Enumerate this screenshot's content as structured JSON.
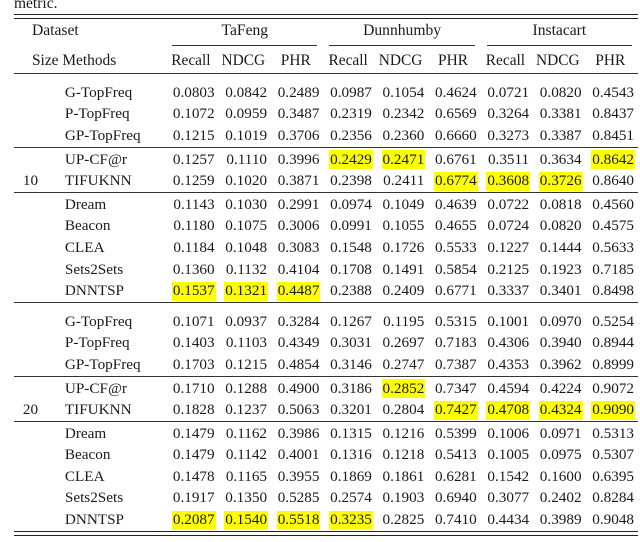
{
  "caption_tail": "metric.",
  "highlight_color": "#ffff00",
  "header": {
    "col_dataset": "Dataset",
    "col_size_methods": "Size Methods",
    "groups": [
      "TaFeng",
      "Dunnhumby",
      "Instacart"
    ],
    "metrics": [
      "Recall",
      "NDCG",
      "PHR"
    ],
    "subheaders": [
      "Recall",
      "NDCG",
      "PHR",
      "Recall",
      "NDCG",
      "PHR",
      "Recall",
      "NDCG",
      "PHR"
    ]
  },
  "sections": [
    {
      "size": "10",
      "size_row_index": 1,
      "blocks": [
        {
          "rows": [
            {
              "method": "G-TopFreq",
              "values": [
                "0.0803",
                "0.0842",
                "0.2489",
                "0.0987",
                "0.1054",
                "0.4624",
                "0.0721",
                "0.0820",
                "0.4543"
              ],
              "highlight": [
                false,
                false,
                false,
                false,
                false,
                false,
                false,
                false,
                false
              ]
            },
            {
              "method": "P-TopFreq",
              "values": [
                "0.1072",
                "0.0959",
                "0.3487",
                "0.2319",
                "0.2342",
                "0.6569",
                "0.3264",
                "0.3381",
                "0.8437"
              ],
              "highlight": [
                false,
                false,
                false,
                false,
                false,
                false,
                false,
                false,
                false
              ]
            },
            {
              "method": "GP-TopFreq",
              "values": [
                "0.1215",
                "0.1019",
                "0.3706",
                "0.2356",
                "0.2360",
                "0.6660",
                "0.3273",
                "0.3387",
                "0.8451"
              ],
              "highlight": [
                false,
                false,
                false,
                false,
                false,
                false,
                false,
                false,
                false
              ]
            }
          ]
        },
        {
          "rows": [
            {
              "method": "UP-CF@r",
              "values": [
                "0.1257",
                "0.1110",
                "0.3996",
                "0.2429",
                "0.2471",
                "0.6761",
                "0.3511",
                "0.3634",
                "0.8642"
              ],
              "highlight": [
                false,
                false,
                false,
                true,
                true,
                false,
                false,
                false,
                true
              ]
            },
            {
              "method": "TIFUKNN",
              "values": [
                "0.1259",
                "0.1020",
                "0.3871",
                "0.2398",
                "0.2411",
                "0.6774",
                "0.3608",
                "0.3726",
                "0.8640"
              ],
              "highlight": [
                false,
                false,
                false,
                false,
                false,
                true,
                true,
                true,
                false
              ]
            }
          ]
        },
        {
          "rows": [
            {
              "method": "Dream",
              "values": [
                "0.1143",
                "0.1030",
                "0.2991",
                "0.0974",
                "0.1049",
                "0.4639",
                "0.0722",
                "0.0818",
                "0.4560"
              ],
              "highlight": [
                false,
                false,
                false,
                false,
                false,
                false,
                false,
                false,
                false
              ]
            },
            {
              "method": "Beacon",
              "values": [
                "0.1180",
                "0.1075",
                "0.3006",
                "0.0991",
                "0.1055",
                "0.4655",
                "0.0724",
                "0.0820",
                "0.4575"
              ],
              "highlight": [
                false,
                false,
                false,
                false,
                false,
                false,
                false,
                false,
                false
              ]
            },
            {
              "method": "CLEA",
              "values": [
                "0.1184",
                "0.1048",
                "0.3083",
                "0.1548",
                "0.1726",
                "0.5533",
                "0.1227",
                "0.1444",
                "0.5633"
              ],
              "highlight": [
                false,
                false,
                false,
                false,
                false,
                false,
                false,
                false,
                false
              ]
            },
            {
              "method": "Sets2Sets",
              "values": [
                "0.1360",
                "0.1132",
                "0.4104",
                "0.1708",
                "0.1491",
                "0.5854",
                "0.2125",
                "0.1923",
                "0.7185"
              ],
              "highlight": [
                false,
                false,
                false,
                false,
                false,
                false,
                false,
                false,
                false
              ]
            },
            {
              "method": "DNNTSP",
              "values": [
                "0.1537",
                "0.1321",
                "0.4487",
                "0.2388",
                "0.2409",
                "0.6771",
                "0.3337",
                "0.3401",
                "0.8498"
              ],
              "highlight": [
                true,
                true,
                true,
                false,
                false,
                false,
                false,
                false,
                false
              ]
            }
          ]
        }
      ]
    },
    {
      "size": "20",
      "size_row_index": 1,
      "blocks": [
        {
          "rows": [
            {
              "method": "G-TopFreq",
              "values": [
                "0.1071",
                "0.0937",
                "0.3284",
                "0.1267",
                "0.1195",
                "0.5315",
                "0.1001",
                "0.0970",
                "0.5254"
              ],
              "highlight": [
                false,
                false,
                false,
                false,
                false,
                false,
                false,
                false,
                false
              ]
            },
            {
              "method": "P-TopFreq",
              "values": [
                "0.1403",
                "0.1103",
                "0.4349",
                "0.3031",
                "0.2697",
                "0.7183",
                "0.4306",
                "0.3940",
                "0.8944"
              ],
              "highlight": [
                false,
                false,
                false,
                false,
                false,
                false,
                false,
                false,
                false
              ]
            },
            {
              "method": "GP-TopFreq",
              "values": [
                "0.1703",
                "0.1215",
                "0.4854",
                "0.3146",
                "0.2747",
                "0.7387",
                "0.4353",
                "0.3962",
                "0.8999"
              ],
              "highlight": [
                false,
                false,
                false,
                false,
                false,
                false,
                false,
                false,
                false
              ]
            }
          ]
        },
        {
          "rows": [
            {
              "method": "UP-CF@r",
              "values": [
                "0.1710",
                "0.1288",
                "0.4900",
                "0.3186",
                "0.2852",
                "0.7347",
                "0.4594",
                "0.4224",
                "0.9072"
              ],
              "highlight": [
                false,
                false,
                false,
                false,
                true,
                false,
                false,
                false,
                false
              ]
            },
            {
              "method": "TIFUKNN",
              "values": [
                "0.1828",
                "0.1237",
                "0.5063",
                "0.3201",
                "0.2804",
                "0.7427",
                "0.4708",
                "0.4324",
                "0.9090"
              ],
              "highlight": [
                false,
                false,
                false,
                false,
                false,
                true,
                true,
                true,
                true
              ]
            }
          ]
        },
        {
          "rows": [
            {
              "method": "Dream",
              "values": [
                "0.1479",
                "0.1162",
                "0.3986",
                "0.1315",
                "0.1216",
                "0.5399",
                "0.1006",
                "0.0971",
                "0.5313"
              ],
              "highlight": [
                false,
                false,
                false,
                false,
                false,
                false,
                false,
                false,
                false
              ]
            },
            {
              "method": "Beacon",
              "values": [
                "0.1479",
                "0.1142",
                "0.4001",
                "0.1316",
                "0.1218",
                "0.5413",
                "0.1005",
                "0.0975",
                "0.5307"
              ],
              "highlight": [
                false,
                false,
                false,
                false,
                false,
                false,
                false,
                false,
                false
              ]
            },
            {
              "method": "CLEA",
              "values": [
                "0.1478",
                "0.1165",
                "0.3955",
                "0.1869",
                "0.1861",
                "0.6281",
                "0.1542",
                "0.1600",
                "0.6395"
              ],
              "highlight": [
                false,
                false,
                false,
                false,
                false,
                false,
                false,
                false,
                false
              ]
            },
            {
              "method": "Sets2Sets",
              "values": [
                "0.1917",
                "0.1350",
                "0.5285",
                "0.2574",
                "0.1903",
                "0.6940",
                "0.3077",
                "0.2402",
                "0.8284"
              ],
              "highlight": [
                false,
                false,
                false,
                false,
                false,
                false,
                false,
                false,
                false
              ]
            },
            {
              "method": "DNNTSP",
              "values": [
                "0.2087",
                "0.1540",
                "0.5518",
                "0.3235",
                "0.2825",
                "0.7410",
                "0.4434",
                "0.3989",
                "0.9048"
              ],
              "highlight": [
                true,
                true,
                true,
                true,
                false,
                false,
                false,
                false,
                false
              ]
            }
          ]
        }
      ]
    }
  ]
}
